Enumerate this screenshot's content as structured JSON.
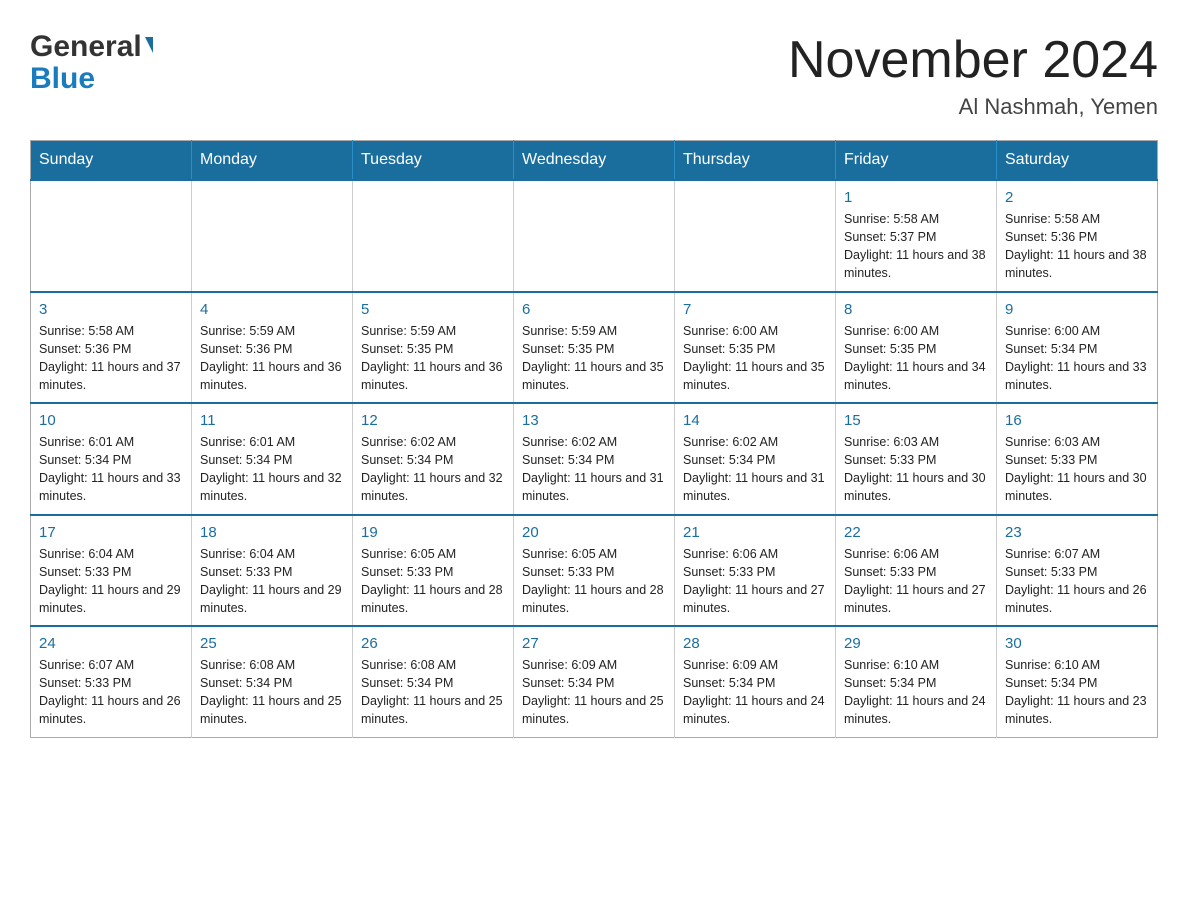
{
  "logo": {
    "general": "General",
    "blue": "Blue"
  },
  "title": "November 2024",
  "subtitle": "Al Nashmah, Yemen",
  "weekdays": [
    "Sunday",
    "Monday",
    "Tuesday",
    "Wednesday",
    "Thursday",
    "Friday",
    "Saturday"
  ],
  "weeks": [
    [
      {
        "num": "",
        "info": ""
      },
      {
        "num": "",
        "info": ""
      },
      {
        "num": "",
        "info": ""
      },
      {
        "num": "",
        "info": ""
      },
      {
        "num": "",
        "info": ""
      },
      {
        "num": "1",
        "info": "Sunrise: 5:58 AM\nSunset: 5:37 PM\nDaylight: 11 hours and 38 minutes."
      },
      {
        "num": "2",
        "info": "Sunrise: 5:58 AM\nSunset: 5:36 PM\nDaylight: 11 hours and 38 minutes."
      }
    ],
    [
      {
        "num": "3",
        "info": "Sunrise: 5:58 AM\nSunset: 5:36 PM\nDaylight: 11 hours and 37 minutes."
      },
      {
        "num": "4",
        "info": "Sunrise: 5:59 AM\nSunset: 5:36 PM\nDaylight: 11 hours and 36 minutes."
      },
      {
        "num": "5",
        "info": "Sunrise: 5:59 AM\nSunset: 5:35 PM\nDaylight: 11 hours and 36 minutes."
      },
      {
        "num": "6",
        "info": "Sunrise: 5:59 AM\nSunset: 5:35 PM\nDaylight: 11 hours and 35 minutes."
      },
      {
        "num": "7",
        "info": "Sunrise: 6:00 AM\nSunset: 5:35 PM\nDaylight: 11 hours and 35 minutes."
      },
      {
        "num": "8",
        "info": "Sunrise: 6:00 AM\nSunset: 5:35 PM\nDaylight: 11 hours and 34 minutes."
      },
      {
        "num": "9",
        "info": "Sunrise: 6:00 AM\nSunset: 5:34 PM\nDaylight: 11 hours and 33 minutes."
      }
    ],
    [
      {
        "num": "10",
        "info": "Sunrise: 6:01 AM\nSunset: 5:34 PM\nDaylight: 11 hours and 33 minutes."
      },
      {
        "num": "11",
        "info": "Sunrise: 6:01 AM\nSunset: 5:34 PM\nDaylight: 11 hours and 32 minutes."
      },
      {
        "num": "12",
        "info": "Sunrise: 6:02 AM\nSunset: 5:34 PM\nDaylight: 11 hours and 32 minutes."
      },
      {
        "num": "13",
        "info": "Sunrise: 6:02 AM\nSunset: 5:34 PM\nDaylight: 11 hours and 31 minutes."
      },
      {
        "num": "14",
        "info": "Sunrise: 6:02 AM\nSunset: 5:34 PM\nDaylight: 11 hours and 31 minutes."
      },
      {
        "num": "15",
        "info": "Sunrise: 6:03 AM\nSunset: 5:33 PM\nDaylight: 11 hours and 30 minutes."
      },
      {
        "num": "16",
        "info": "Sunrise: 6:03 AM\nSunset: 5:33 PM\nDaylight: 11 hours and 30 minutes."
      }
    ],
    [
      {
        "num": "17",
        "info": "Sunrise: 6:04 AM\nSunset: 5:33 PM\nDaylight: 11 hours and 29 minutes."
      },
      {
        "num": "18",
        "info": "Sunrise: 6:04 AM\nSunset: 5:33 PM\nDaylight: 11 hours and 29 minutes."
      },
      {
        "num": "19",
        "info": "Sunrise: 6:05 AM\nSunset: 5:33 PM\nDaylight: 11 hours and 28 minutes."
      },
      {
        "num": "20",
        "info": "Sunrise: 6:05 AM\nSunset: 5:33 PM\nDaylight: 11 hours and 28 minutes."
      },
      {
        "num": "21",
        "info": "Sunrise: 6:06 AM\nSunset: 5:33 PM\nDaylight: 11 hours and 27 minutes."
      },
      {
        "num": "22",
        "info": "Sunrise: 6:06 AM\nSunset: 5:33 PM\nDaylight: 11 hours and 27 minutes."
      },
      {
        "num": "23",
        "info": "Sunrise: 6:07 AM\nSunset: 5:33 PM\nDaylight: 11 hours and 26 minutes."
      }
    ],
    [
      {
        "num": "24",
        "info": "Sunrise: 6:07 AM\nSunset: 5:33 PM\nDaylight: 11 hours and 26 minutes."
      },
      {
        "num": "25",
        "info": "Sunrise: 6:08 AM\nSunset: 5:34 PM\nDaylight: 11 hours and 25 minutes."
      },
      {
        "num": "26",
        "info": "Sunrise: 6:08 AM\nSunset: 5:34 PM\nDaylight: 11 hours and 25 minutes."
      },
      {
        "num": "27",
        "info": "Sunrise: 6:09 AM\nSunset: 5:34 PM\nDaylight: 11 hours and 25 minutes."
      },
      {
        "num": "28",
        "info": "Sunrise: 6:09 AM\nSunset: 5:34 PM\nDaylight: 11 hours and 24 minutes."
      },
      {
        "num": "29",
        "info": "Sunrise: 6:10 AM\nSunset: 5:34 PM\nDaylight: 11 hours and 24 minutes."
      },
      {
        "num": "30",
        "info": "Sunrise: 6:10 AM\nSunset: 5:34 PM\nDaylight: 11 hours and 23 minutes."
      }
    ]
  ]
}
